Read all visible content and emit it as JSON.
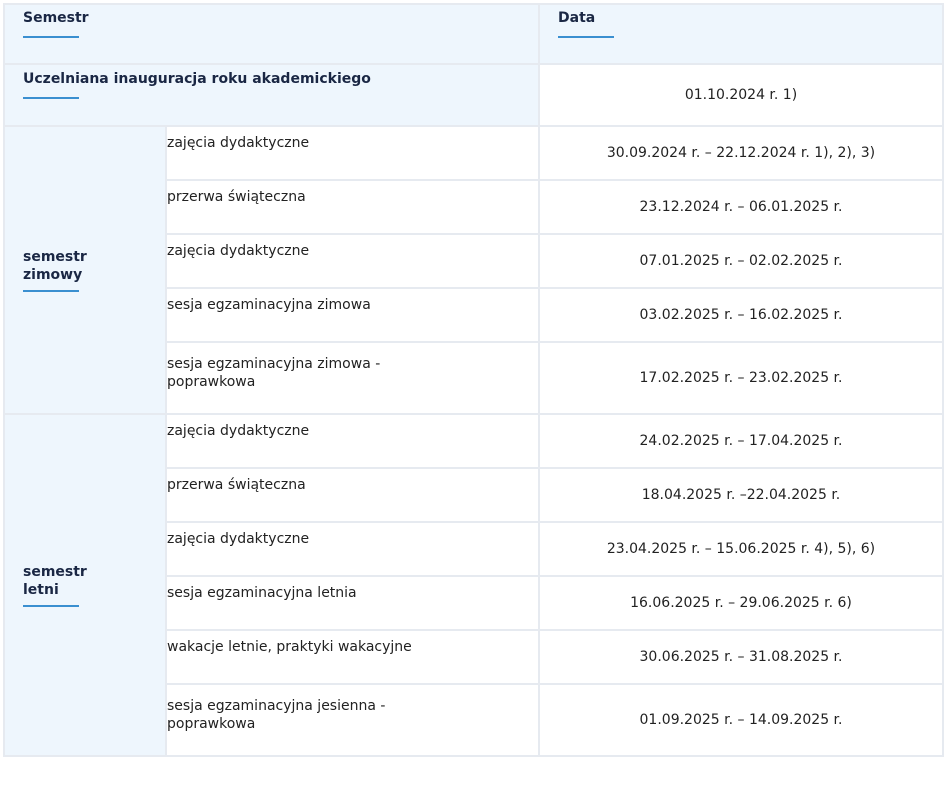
{
  "header": {
    "semestr": "Semestr",
    "data": "Data"
  },
  "inauguration": {
    "label": "Uczelniana inauguracja roku akademickiego",
    "date": "01.10.2024 r. 1)"
  },
  "semesters": [
    {
      "name_line1": "semestr",
      "name_line2": "zimowy",
      "rows": [
        {
          "activity": "zajęcia dydaktyczne",
          "date": "30.09.2024 r. – 22.12.2024 r. 1), 2), 3)"
        },
        {
          "activity": "przerwa świąteczna",
          "date": "23.12.2024 r. – 06.01.2025 r."
        },
        {
          "activity": "zajęcia dydaktyczne",
          "date": "07.01.2025 r. – 02.02.2025 r."
        },
        {
          "activity": "sesja egzaminacyjna zimowa",
          "date": "03.02.2025 r. – 16.02.2025 r."
        },
        {
          "activity": "sesja egzaminacyjna zimowa - poprawkowa",
          "date": "17.02.2025 r. – 23.02.2025 r."
        }
      ]
    },
    {
      "name_line1": "semestr",
      "name_line2": "letni",
      "rows": [
        {
          "activity": "zajęcia dydaktyczne",
          "date": "24.02.2025 r. – 17.04.2025 r."
        },
        {
          "activity": "przerwa świąteczna",
          "date": "18.04.2025 r. –22.04.2025 r."
        },
        {
          "activity": "zajęcia dydaktyczne",
          "date": "23.04.2025 r. – 15.06.2025 r. 4), 5), 6)"
        },
        {
          "activity": "sesja egzaminacyjna letnia",
          "date": "16.06.2025  r. – 29.06.2025 r. 6)"
        },
        {
          "activity": "wakacje letnie, praktyki wakacyjne",
          "date": "30.06.2025 r. – 31.08.2025 r."
        },
        {
          "activity": "sesja egzaminacyjna jesienna - poprawkowa",
          "date": "01.09.2025 r. – 14.09.2025 r."
        }
      ]
    }
  ],
  "colors": {
    "header_bg": "#eef6fd",
    "underline": "#3a8fd0",
    "border": "#e6eaf0",
    "heading_text": "#1a2744"
  }
}
